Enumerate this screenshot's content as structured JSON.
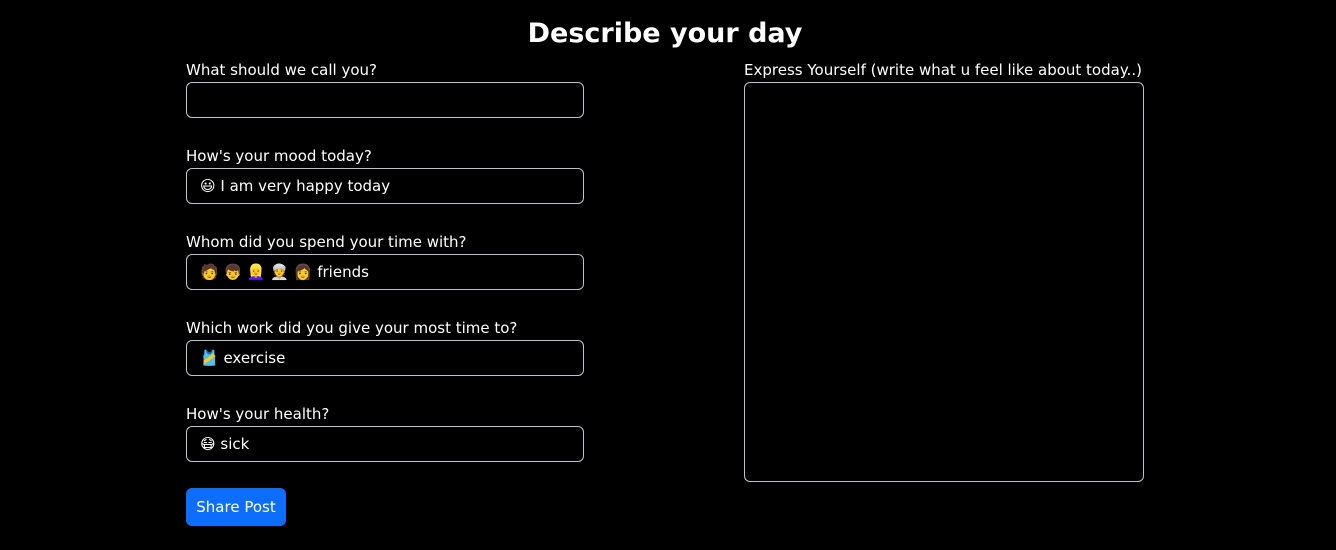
{
  "header": {
    "title": "Describe your day"
  },
  "form": {
    "name": {
      "label": "What should we call you?",
      "value": ""
    },
    "mood": {
      "label": "How's your mood today?",
      "value": "😃 I am very happy today"
    },
    "company": {
      "label": "Whom did you spend your time with?",
      "value": "🧑 👦 👱‍♀️ 👳 👩 friends"
    },
    "work": {
      "label": "Which work did you give your most time to?",
      "value": "🎽 exercise"
    },
    "health": {
      "label": "How's your health?",
      "value": "😷 sick"
    },
    "express": {
      "label": "Express Yourself (write what u feel like about today..)",
      "value": ""
    },
    "submit_label": "Share Post"
  },
  "colors": {
    "background": "#000000",
    "field_border": "#b9c4ce",
    "button": "#0d6efd",
    "text": "#ffffff"
  }
}
